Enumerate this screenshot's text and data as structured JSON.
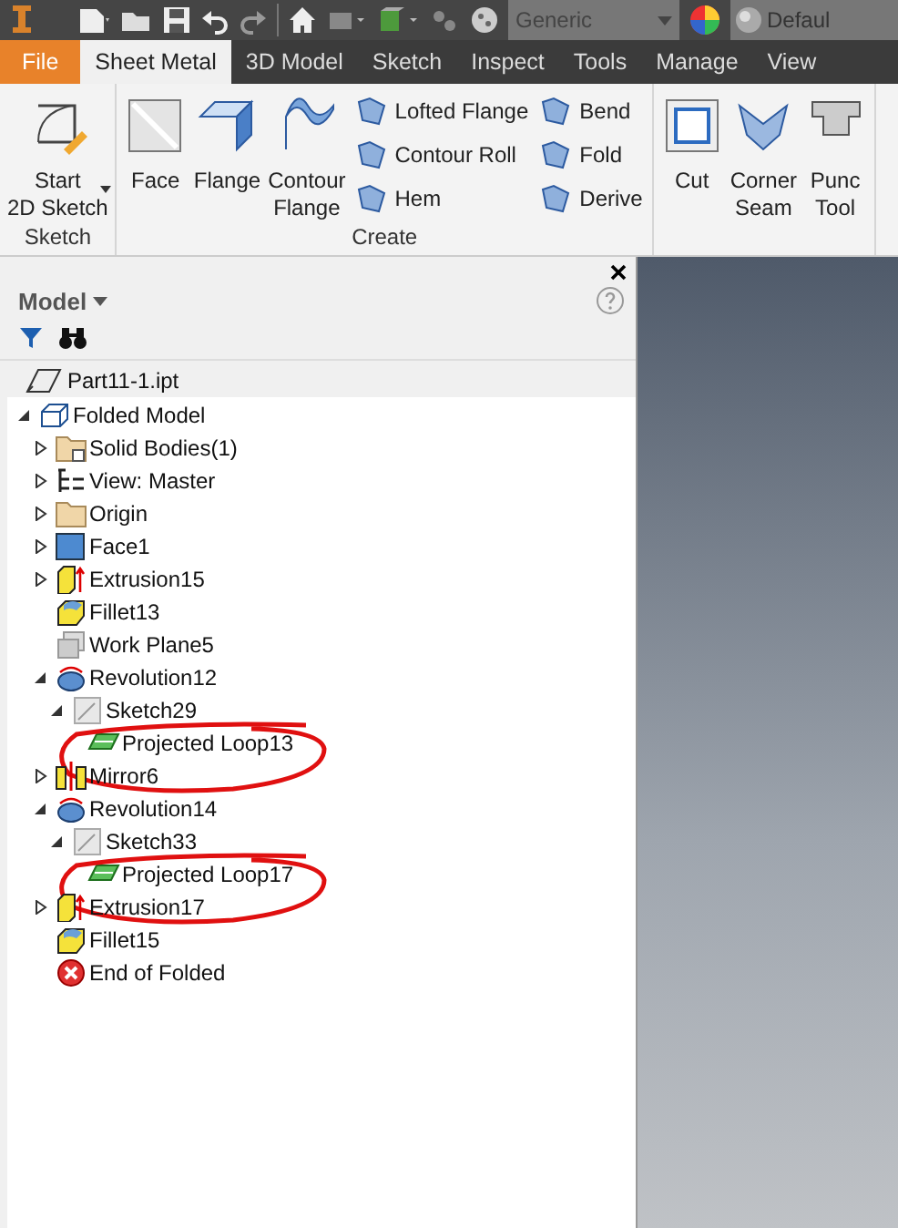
{
  "quick_access": {
    "material": "Generic",
    "appearance": "Defaul"
  },
  "tabs": [
    {
      "label": "File",
      "kind": "file",
      "selected": false
    },
    {
      "label": "Sheet Metal",
      "kind": "tab",
      "selected": true
    },
    {
      "label": "3D Model",
      "kind": "tab",
      "selected": false
    },
    {
      "label": "Sketch",
      "kind": "tab",
      "selected": false
    },
    {
      "label": "Inspect",
      "kind": "tab",
      "selected": false
    },
    {
      "label": "Tools",
      "kind": "tab",
      "selected": false
    },
    {
      "label": "Manage",
      "kind": "tab",
      "selected": false
    },
    {
      "label": "View",
      "kind": "tab",
      "selected": false
    }
  ],
  "ribbon": [
    {
      "label": "Sketch",
      "tools": [
        {
          "kind": "large",
          "lines": [
            "Start",
            "2D Sketch"
          ],
          "dropdown": true
        }
      ]
    },
    {
      "label": "Create",
      "tools": [
        {
          "kind": "large",
          "lines": [
            "Face"
          ]
        },
        {
          "kind": "large",
          "lines": [
            "Flange"
          ]
        },
        {
          "kind": "large",
          "lines": [
            "Contour",
            "Flange"
          ]
        },
        {
          "kind": "small",
          "items": [
            {
              "label": "Lofted Flange"
            },
            {
              "label": "Contour Roll"
            },
            {
              "label": "Hem"
            }
          ]
        },
        {
          "kind": "small",
          "items": [
            {
              "label": "Bend"
            },
            {
              "label": "Fold"
            },
            {
              "label": "Derive"
            }
          ]
        }
      ]
    },
    {
      "tools": [
        {
          "kind": "large",
          "lines": [
            "Cut"
          ]
        },
        {
          "kind": "large",
          "lines": [
            "Corner",
            "Seam"
          ]
        },
        {
          "kind": "large",
          "lines": [
            "Punc",
            "Tool"
          ]
        }
      ]
    }
  ],
  "browser": {
    "title": "Model",
    "root": "Part11-1.ipt",
    "tree": [
      {
        "label": "Folded Model",
        "kind": "model",
        "expanded": true,
        "children": [
          {
            "label": "Solid Bodies(1)",
            "kind": "bodies",
            "expanded": false
          },
          {
            "label": "View: Master",
            "kind": "view",
            "expanded": false
          },
          {
            "label": "Origin",
            "kind": "folder",
            "expanded": false
          },
          {
            "label": "Face1",
            "kind": "face",
            "expanded": false
          },
          {
            "label": "Extrusion15",
            "kind": "extrusion",
            "expanded": false
          },
          {
            "label": "Fillet13",
            "kind": "fillet"
          },
          {
            "label": "Work Plane5",
            "kind": "plane"
          },
          {
            "label": "Revolution12",
            "kind": "revolution",
            "expanded": true,
            "children": [
              {
                "label": "Sketch29",
                "kind": "sketch",
                "expanded": true,
                "children": [
                  {
                    "label": "Projected Loop13",
                    "kind": "loop",
                    "circled": true
                  }
                ]
              }
            ]
          },
          {
            "label": "Mirror6",
            "kind": "mirror",
            "expanded": false
          },
          {
            "label": "Revolution14",
            "kind": "revolution",
            "expanded": true,
            "children": [
              {
                "label": "Sketch33",
                "kind": "sketch",
                "expanded": true,
                "children": [
                  {
                    "label": "Projected Loop17",
                    "kind": "loop",
                    "circled": true
                  }
                ]
              }
            ]
          },
          {
            "label": "Extrusion17",
            "kind": "extrusion",
            "expanded": false
          },
          {
            "label": "Fillet15",
            "kind": "fillet"
          },
          {
            "label": "End of Folded",
            "kind": "end"
          }
        ]
      }
    ]
  }
}
